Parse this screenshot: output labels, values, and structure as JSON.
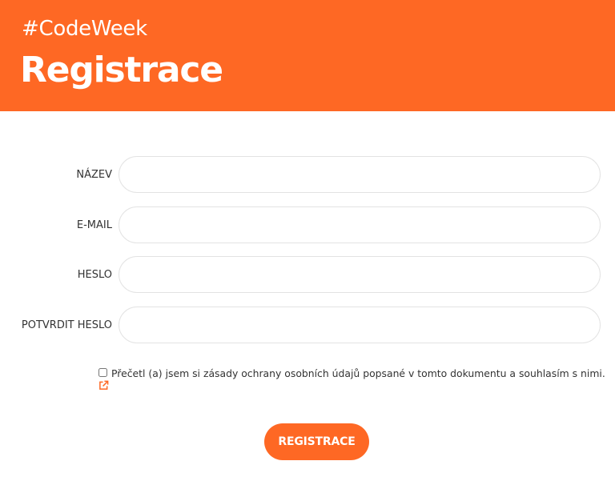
{
  "header": {
    "tag": "#CodeWeek",
    "title": "Registrace",
    "background_color": "#fe6824"
  },
  "form": {
    "fields": [
      {
        "label": "NÁZEV",
        "value": "",
        "placeholder": ""
      },
      {
        "label": "E-MAIL",
        "value": "",
        "placeholder": ""
      },
      {
        "label": "HESLO",
        "value": "",
        "placeholder": ""
      },
      {
        "label": "POTVRDIT HESLO",
        "value": "",
        "placeholder": ""
      }
    ],
    "consent": {
      "checked": false,
      "text": "Přečetl (a) jsem si zásady ochrany osobních údajů popsané v tomto dokumentu a souhlasím s nimi.",
      "link_icon": "external-link-icon"
    },
    "submit_label": "REGISTRACE",
    "accent_color": "#fe6824"
  }
}
